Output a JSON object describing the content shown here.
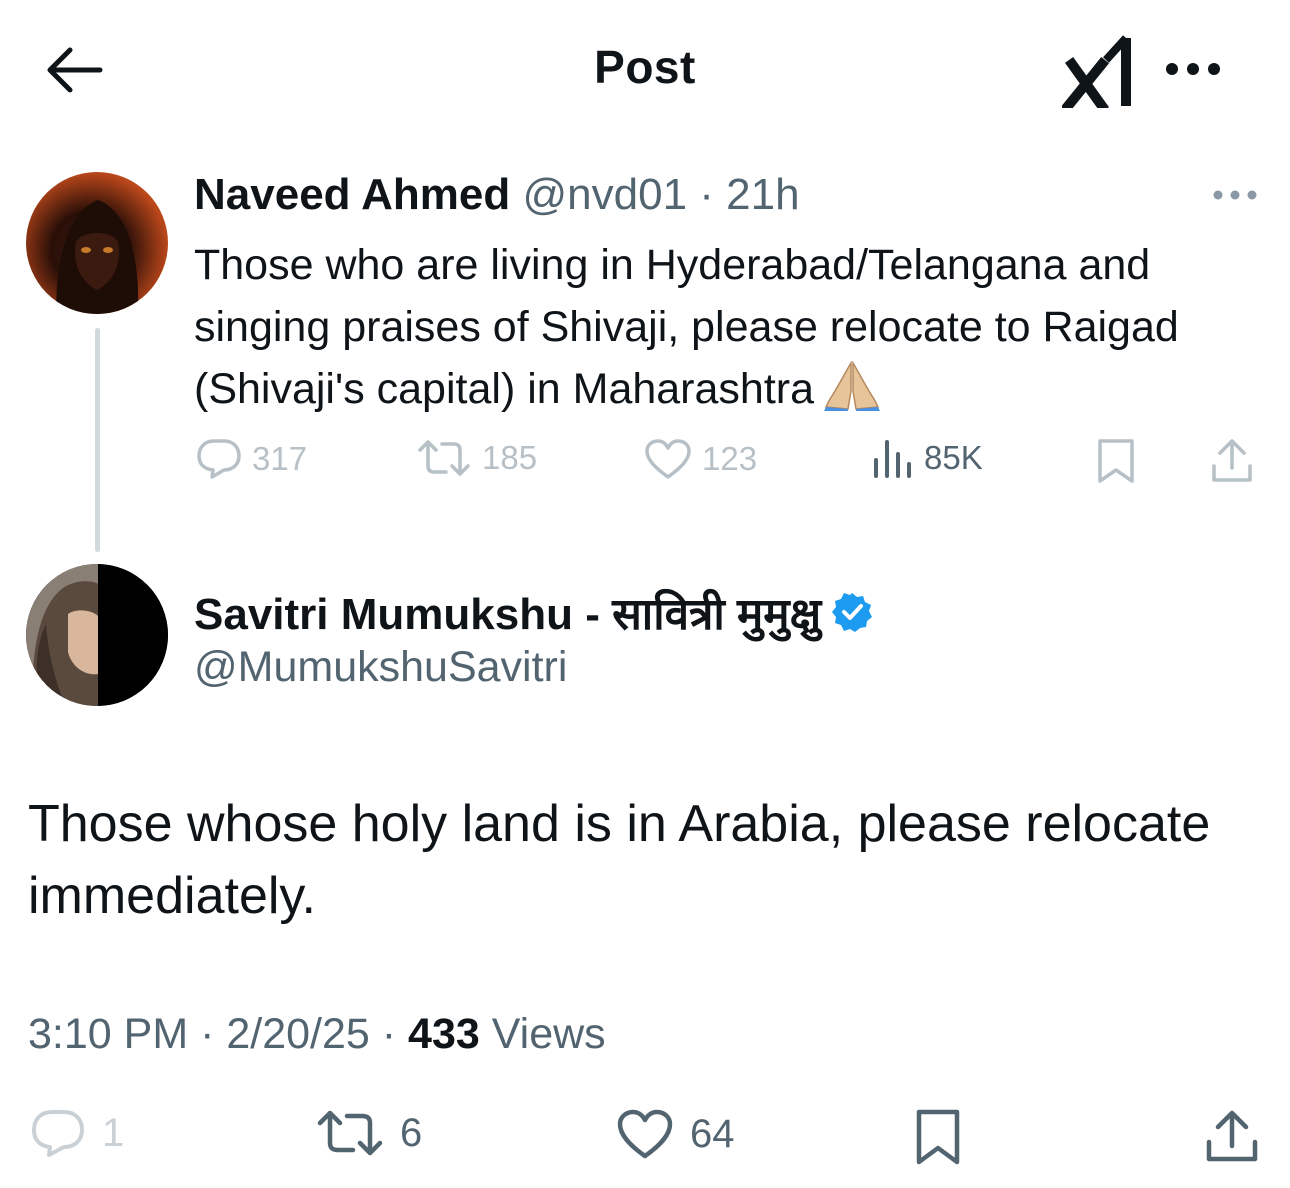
{
  "header": {
    "title": "Post",
    "back_icon": "arrow-left-icon",
    "grok_icon": "grok-logo-icon",
    "more_icon": "more-horizontal-icon"
  },
  "parent_post": {
    "author_name": "Naveed Ahmed",
    "author_handle": "@nvd01",
    "separator": " · ",
    "time": "21h",
    "text": "Those who are living in Hyderabad/Telangana and singing praises of Shivaji, please relocate to Raigad (Shivaji's capital) in Maharashtra",
    "emoji": "folded-hands-emoji",
    "replies": "317",
    "reposts": "185",
    "likes": "123",
    "views": "85K"
  },
  "main_post": {
    "author_name": "Savitri Mumukshu - सावित्री मुमुक्षु",
    "author_handle": "@MumukshuSavitri",
    "verified_color": "#1d9bf0",
    "text": "Those whose holy land is in Arabia, please relocate immediately.",
    "time": "3:10 PM",
    "separator": " · ",
    "date": "2/20/25",
    "views_count": "433",
    "views_label": " Views",
    "replies": "1",
    "reposts": "6",
    "likes": "64"
  },
  "colors": {
    "text": "#0f1419",
    "secondary": "#536471",
    "muted": "#b7c0c6",
    "accent": "#1d9bf0",
    "thread_line": "#cfd9de"
  }
}
